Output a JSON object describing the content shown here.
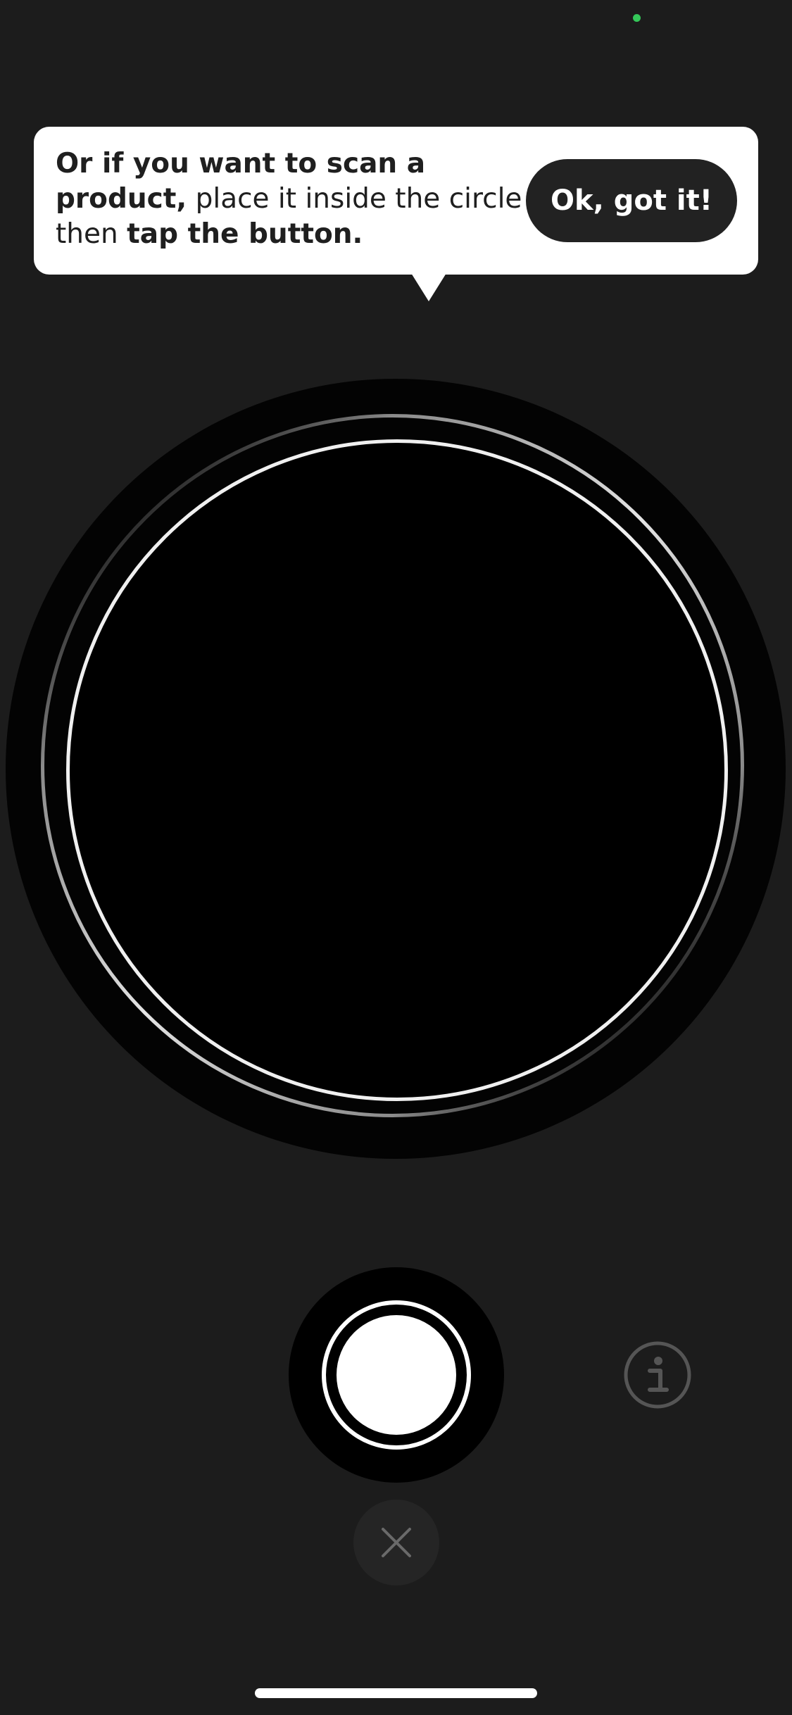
{
  "status": {
    "privacy_indicator_color": "#34c759"
  },
  "tooltip": {
    "text_bold_1": "Or if you want to scan a product,",
    "text_regular": " place it inside the circle then ",
    "text_bold_2": "tap the button.",
    "ok_label": "Ok, got it!"
  },
  "controls": {
    "shutter_icon": "shutter-button",
    "info_icon": "info-icon",
    "close_icon": "close-icon"
  },
  "colors": {
    "background": "#1c1c1c",
    "tooltip_bg": "#ffffff",
    "button_dark": "#222222",
    "ring": "#f0f0f0"
  }
}
